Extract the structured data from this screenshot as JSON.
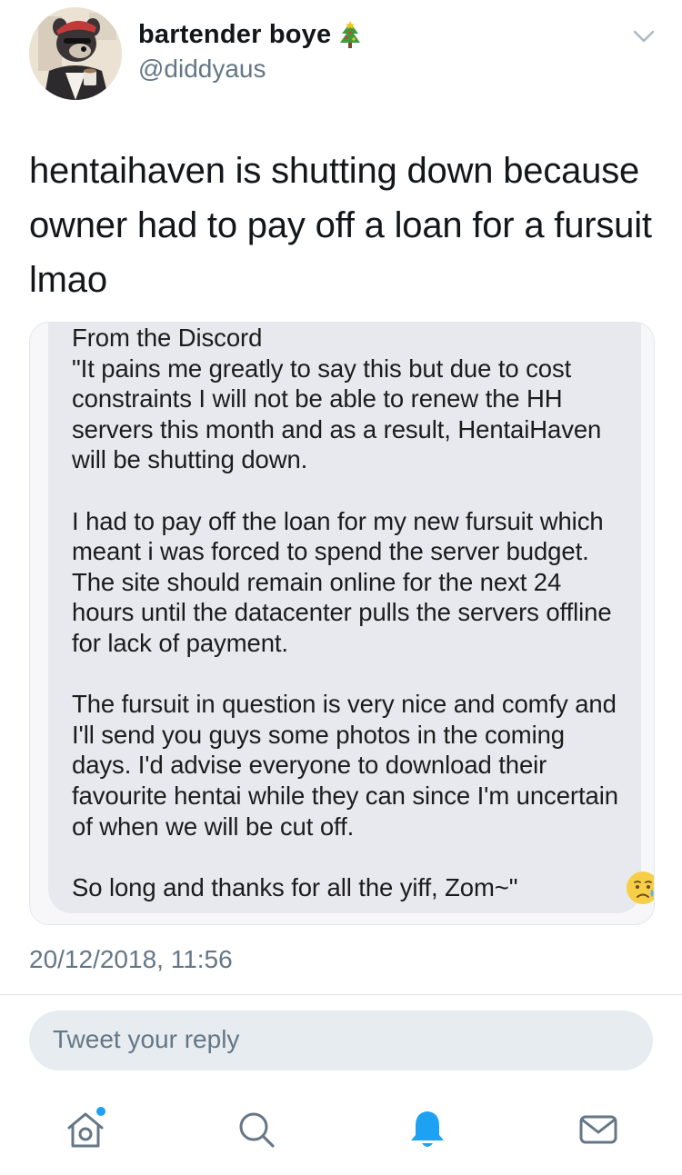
{
  "tweet": {
    "author": {
      "display_name": "bartender boye",
      "name_emoji": "christmas-tree-icon",
      "handle": "@diddyaus"
    },
    "text": "hentaihaven is shutting down because owner had to pay off a loan for a fursuit lmao",
    "timestamp": "20/12/2018, 11:56"
  },
  "media": {
    "text": "From the Discord\n\"It pains me greatly to say this but due to cost constraints I will not be able to renew the HH servers this month and as a result, HentaiHaven will be shutting down.\n\nI had to pay off the loan for my new fursuit which meant i was forced to spend the server budget. The site should remain online for the next 24 hours until the datacenter pulls the servers offline for lack of payment.\n\nThe fursuit in question is very nice and comfy and I'll send you guys some photos in the coming days. I'd advise everyone to download their favourite hentai while they can since I'm uncertain of when we will be cut off.\n\nSo long and thanks for all the yiff, Zom~\"",
    "reaction_icon": "crying-face-icon"
  },
  "reply": {
    "placeholder": "Tweet your reply"
  },
  "tab_bar": {
    "items": [
      {
        "icon": "home-icon",
        "active": false,
        "notification_dot": true
      },
      {
        "icon": "search-icon",
        "active": false
      },
      {
        "icon": "notifications-bell-icon",
        "active": true
      },
      {
        "icon": "messages-envelope-icon",
        "active": false
      }
    ]
  },
  "colors": {
    "primary_text": "#14171a",
    "secondary_text": "#657786",
    "accent": "#1da1f2",
    "reply_box_bg": "#e6ecf0",
    "divider": "#dfe4e8"
  }
}
